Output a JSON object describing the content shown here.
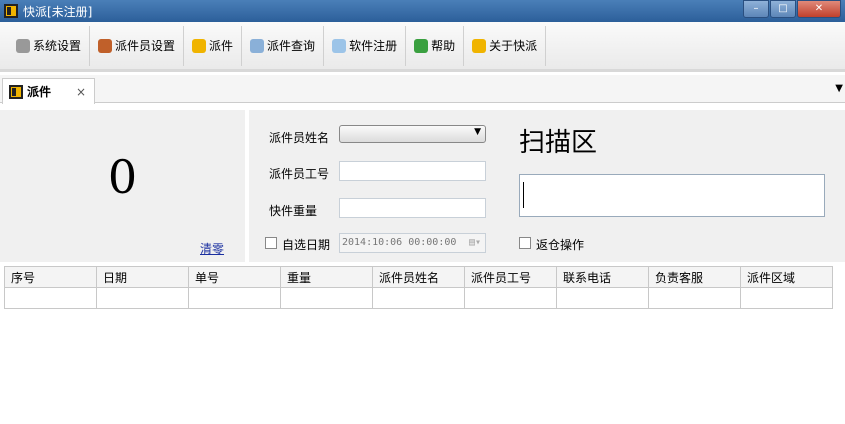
{
  "window": {
    "title": "快派[未注册]"
  },
  "toolbar": [
    {
      "label": "系统设置",
      "icon": "gear-icon",
      "color": "#999999"
    },
    {
      "label": "派件员设置",
      "icon": "user-icon",
      "color": "#c0602a"
    },
    {
      "label": "派件",
      "icon": "app-logo-icon",
      "color": "#f0b400"
    },
    {
      "label": "派件查询",
      "icon": "search-icon",
      "color": "#8ab0d8"
    },
    {
      "label": "软件注册",
      "icon": "folder-icon",
      "color": "#9cc4e8"
    },
    {
      "label": "帮助",
      "icon": "help-icon",
      "color": "#3aa040"
    },
    {
      "label": "关于快派",
      "icon": "app-logo-icon",
      "color": "#f0b400"
    }
  ],
  "tab": {
    "label": "派件",
    "close": "×"
  },
  "left": {
    "count": "0",
    "clear": "清零"
  },
  "form": {
    "courier_name_label": "派件员姓名",
    "courier_id_label": "派件员工号",
    "weight_label": "快件重量",
    "custom_date_label": "自选日期",
    "date_value": "2014:10:06 00:00:00",
    "scan_title": "扫描区",
    "return_label": "返仓操作"
  },
  "table": {
    "columns": [
      "序号",
      "日期",
      "单号",
      "重量",
      "派件员姓名",
      "派件员工号",
      "联系电话",
      "负责客服",
      "派件区域"
    ]
  }
}
